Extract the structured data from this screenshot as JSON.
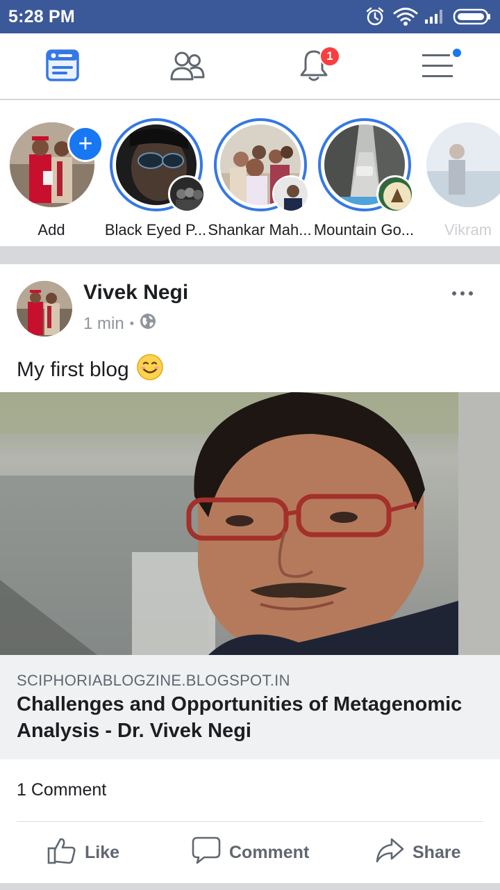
{
  "status_bar": {
    "time": "5:28 PM",
    "icons": [
      "alarm-icon",
      "wifi-icon",
      "signal-icon",
      "battery-icon"
    ]
  },
  "nav": {
    "tabs": [
      {
        "name": "news-feed",
        "icon": "news-feed-icon",
        "active": true
      },
      {
        "name": "friends",
        "icon": "friends-icon",
        "active": false
      },
      {
        "name": "notifications",
        "icon": "bell-icon",
        "active": false,
        "badge": "1"
      },
      {
        "name": "menu",
        "icon": "hamburger-menu-icon",
        "active": false
      }
    ],
    "accent": "#3578e5"
  },
  "stories": [
    {
      "label": "Add"
    },
    {
      "label": "Black Eyed P..."
    },
    {
      "label": "Shankar Mah..."
    },
    {
      "label": "Mountain Go..."
    },
    {
      "label": "Vikram"
    }
  ],
  "post": {
    "author": "Vivek Negi",
    "time": "1 min",
    "separator": "•",
    "privacy_icon": "globe-icon",
    "text": "My first blog",
    "emoji": "😊",
    "link": {
      "domain": "SCIPHORIABLOGZINE.BLOGSPOT.IN",
      "title": "Challenges and Opportunities of Metagenomic Analysis - Dr. Vivek Negi"
    },
    "comments_count": "1 Comment",
    "actions": {
      "like": "Like",
      "comment": "Comment",
      "share": "Share"
    }
  }
}
